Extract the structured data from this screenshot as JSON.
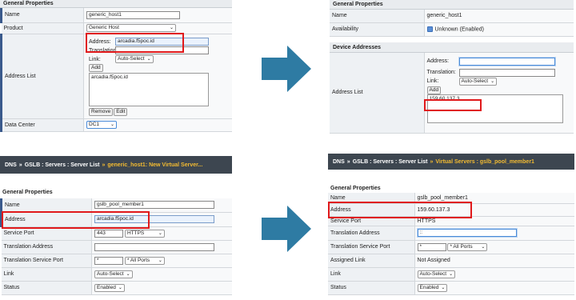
{
  "colors": {
    "arrow": "#2e7ba3",
    "highlight": "#e0191b",
    "breadcrumb_bg": "#3d4650",
    "breadcrumb_current": "#f3bb31"
  },
  "q1": {
    "title": "General Properties",
    "name_label": "Name",
    "name_value": "generic_host1",
    "product_label": "Product",
    "product_value": "Generic Host",
    "addr_list_label": "Address List",
    "address_label": "Address:",
    "address_value": "arcadia.f5poc.id",
    "translation_label": "Translation:",
    "translation_value": "",
    "link_label": "Link:",
    "link_value": "Auto-Select",
    "add_btn": "Add",
    "list_item": "arcadia.f5poc.id",
    "remove_btn": "Remove",
    "edit_btn": "Edit",
    "dc_label": "Data Center",
    "dc_value": "DC1"
  },
  "q2": {
    "title": "General Properties",
    "name_label": "Name",
    "name_value": "generic_host1",
    "avail_label": "Availability",
    "avail_value": "Unknown (Enabled)",
    "dev_title": "Device Addresses",
    "addr_list_label": "Address List",
    "address_label": "Address:",
    "address_value": "",
    "translation_label": "Translation:",
    "translation_value": "",
    "link_label": "Link:",
    "link_value": "Auto-Select",
    "add_btn": "Add",
    "list_item": "159.60.137.3"
  },
  "q3": {
    "bc_root": "DNS",
    "bc_mid": "GSLB : Servers : Server List",
    "bc_cur": "generic_host1: New Virtual Server...",
    "sep": "»",
    "title": "General Properties",
    "name_label": "Name",
    "name_value": "gslb_pool_member1",
    "address_label": "Address",
    "address_value": "arcadia.f5poc.id",
    "port_label": "Service Port",
    "port_value": "443",
    "port_proto": "HTTPS",
    "trans_addr_label": "Translation Address",
    "trans_addr_value": "",
    "trans_port_label": "Translation Service Port",
    "trans_port_value": "*",
    "trans_port_proto": "* All Ports",
    "link_label": "Link",
    "link_value": "Auto-Select",
    "status_label": "Status",
    "status_value": "Enabled"
  },
  "q4": {
    "bc_root": "DNS",
    "bc_mid": "GSLB : Servers : Server List",
    "bc_cur": "Virtual Servers : gslb_pool_member1",
    "sep": "»",
    "title": "General Properties",
    "name_label": "Name",
    "name_value": "gslb_pool_member1",
    "address_label": "Address",
    "address_value": "159.60.137.3",
    "port_label": "Service Port",
    "port_value": "HTTPS",
    "trans_addr_label": "Translation Address",
    "trans_addr_value": "::",
    "trans_port_label": "Translation Service Port",
    "trans_port_value": "*",
    "trans_port_proto": "* All Ports",
    "assigned_label": "Assigned Link",
    "assigned_value": "Not Assigned",
    "link_label": "Link",
    "link_value": "Auto-Select",
    "status_label": "Status",
    "status_value": "Enabled"
  }
}
